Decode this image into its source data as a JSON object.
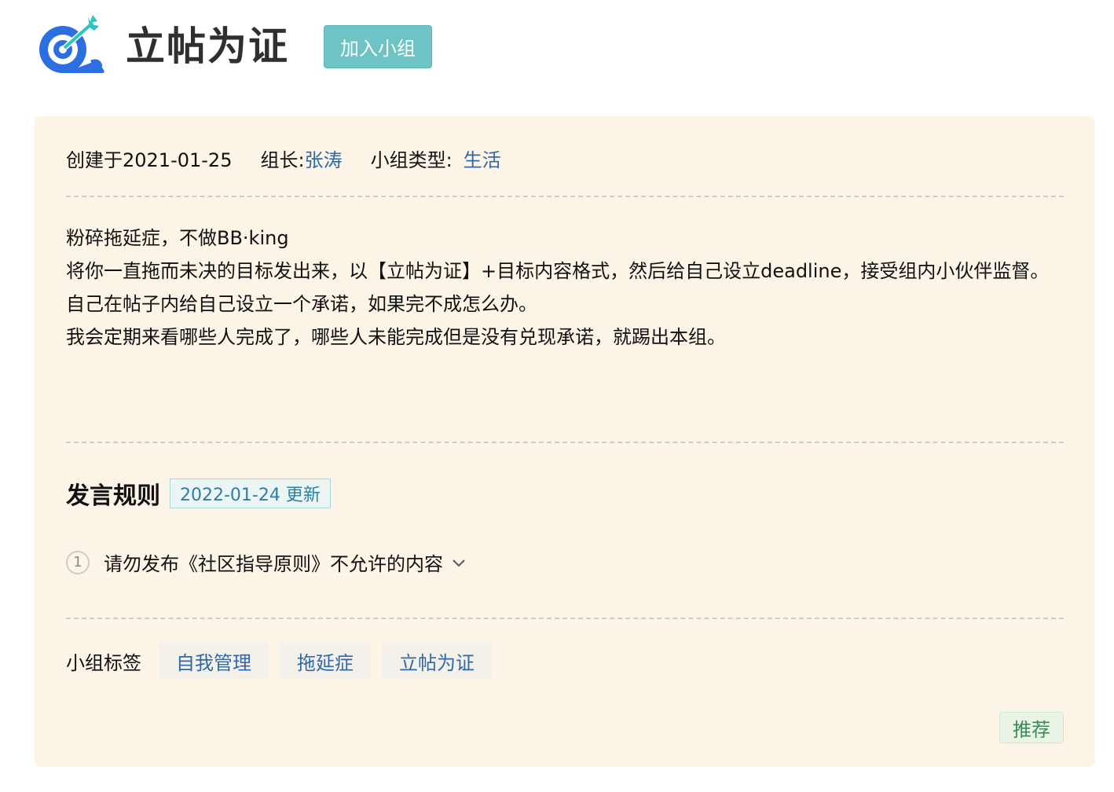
{
  "group": {
    "title": "立帖为证",
    "join_label": "加入小组"
  },
  "meta": {
    "created_label": "创建于2021-01-25",
    "leader_label": "组长:",
    "leader_name": "张涛",
    "type_label": "小组类型:",
    "type_value": "生活"
  },
  "intro": {
    "lines": [
      "粉碎拖延症，不做BB·king",
      "将你一直拖而未决的目标发出来，以【立帖为证】+目标内容格式，然后给自己设立deadline，接受组内小伙伴监督。",
      "自己在帖子内给自己设立一个承诺，如果完不成怎么办。",
      "我会定期来看哪些人完成了，哪些人未能完成但是没有兑现承诺，就踢出本组。"
    ]
  },
  "rules": {
    "title": "发言规则",
    "updated": "2022-01-24 更新",
    "items": [
      {
        "num": "1",
        "text": "请勿发布《社区指导原则》不允许的内容"
      }
    ]
  },
  "tags": {
    "label": "小组标签",
    "items": [
      "自我管理",
      "拖延症",
      "立帖为证"
    ]
  },
  "recommend_label": "推荐",
  "colors": {
    "accent": "#6ec3c5",
    "link": "#2f6aa8",
    "card_bg": "#fdf4e8",
    "logo_blue": "#2b6fe0",
    "logo_cyan": "#2dc3c3"
  }
}
